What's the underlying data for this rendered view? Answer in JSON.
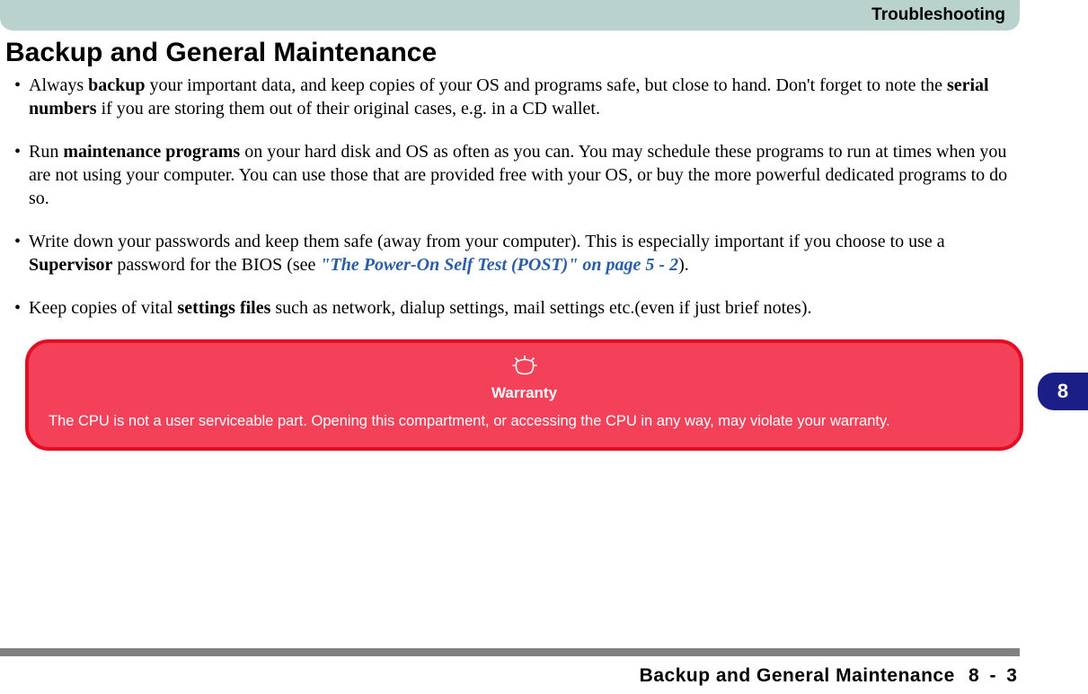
{
  "header": {
    "section": "Troubleshooting"
  },
  "heading": "Backup and General Maintenance",
  "bullets": [
    {
      "pre1": "Always ",
      "b1": "backup",
      "mid1": " your important data, and keep copies of your OS and programs safe, but close to hand. Don't forget to note the ",
      "b2": "serial numbers",
      "post1": " if you are storing them out of their original cases, e.g. in a CD wal­let."
    },
    {
      "pre1": "Run ",
      "b1": "maintenance programs",
      "post1": " on your hard disk and OS as often as you can. You may schedule these pro­grams to run at times when you are not using your computer. You can use those that are provided free with your OS, or buy the more powerful dedicated programs to do so."
    },
    {
      "pre1": "Write down your passwords and keep them safe (away from your computer). This is especially important if you choose to use a ",
      "b1": "Supervisor",
      "mid1": " password for the BIOS (see ",
      "ref": "\"The Power-On Self Test (POST)\" on page 5 - 2",
      "post1": ")."
    },
    {
      "pre1": "Keep copies of vital ",
      "b1": "settings files",
      "post1": " such as network, dialup settings, mail settings etc.(even if just brief notes)."
    }
  ],
  "callout": {
    "title": "Warranty",
    "body": "The CPU is not a user serviceable part. Opening this compartment, or accessing the CPU in any way, may violate your war­ranty."
  },
  "sideTab": "8",
  "footer": {
    "title": "Backup and General Maintenance",
    "page": "8 - 3"
  }
}
